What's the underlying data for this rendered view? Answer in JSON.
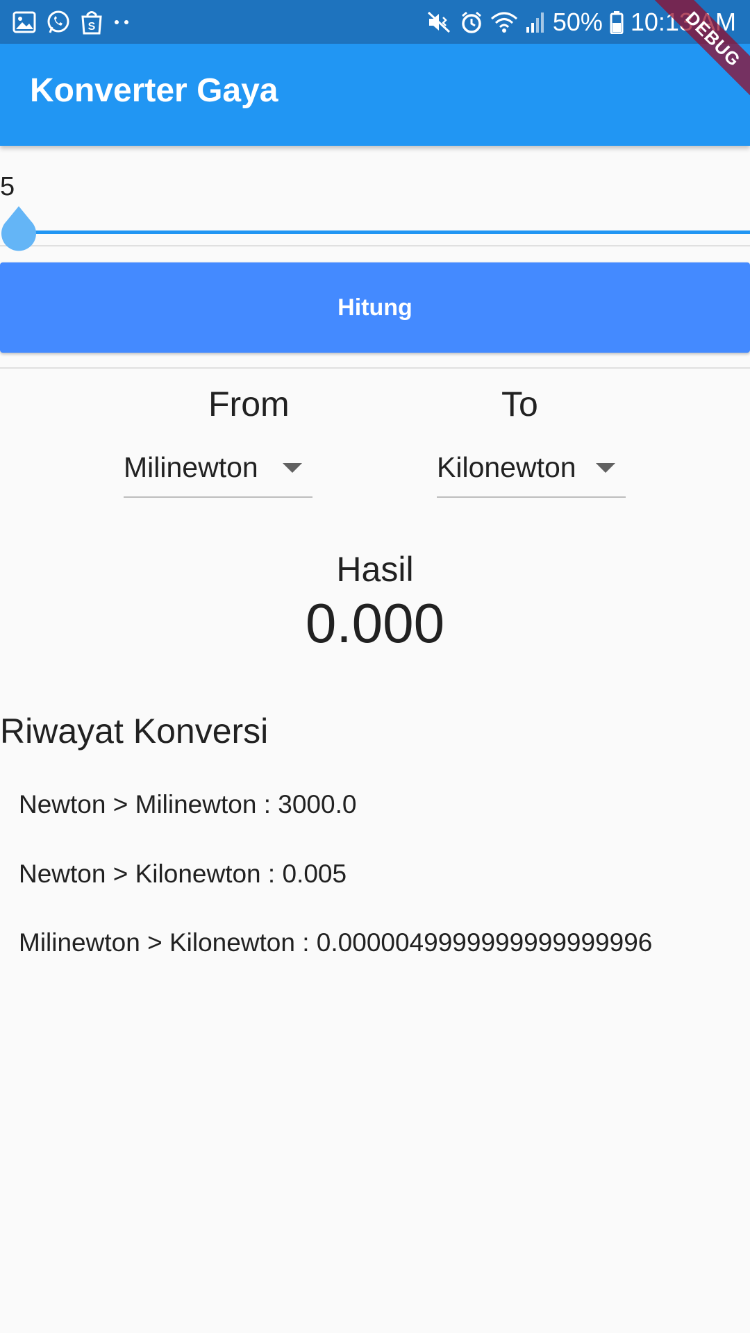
{
  "status_bar": {
    "battery": "50%",
    "time": "10:13 AM",
    "left_icons": [
      "image-icon",
      "whatsapp-icon",
      "shopping-bag-icon",
      "more-dots-icon"
    ],
    "right_icons": [
      "mute-vibrate-icon",
      "alarm-icon",
      "wifi-icon",
      "signal-icon",
      "battery-icon"
    ]
  },
  "debug_banner": "DEBUG",
  "app_bar": {
    "title": "Konverter Gaya",
    "color": "#2196f3"
  },
  "slider": {
    "value_label": "5",
    "fraction": 0.0,
    "track_color": "#2196f3",
    "thumb_color": "#64b5f6"
  },
  "button": {
    "label": "Hitung",
    "color": "#448aff"
  },
  "converter": {
    "from_label": "From",
    "to_label": "To",
    "from_value": "Milinewton",
    "to_value": "Kilonewton"
  },
  "result": {
    "label": "Hasil",
    "value": "0.000"
  },
  "history": {
    "title": "Riwayat Konversi",
    "items": [
      "Newton > Milinewton : 3000.0",
      "Newton > Kilonewton : 0.005",
      "Milinewton > Kilonewton : 0.0000049999999999999996"
    ]
  }
}
